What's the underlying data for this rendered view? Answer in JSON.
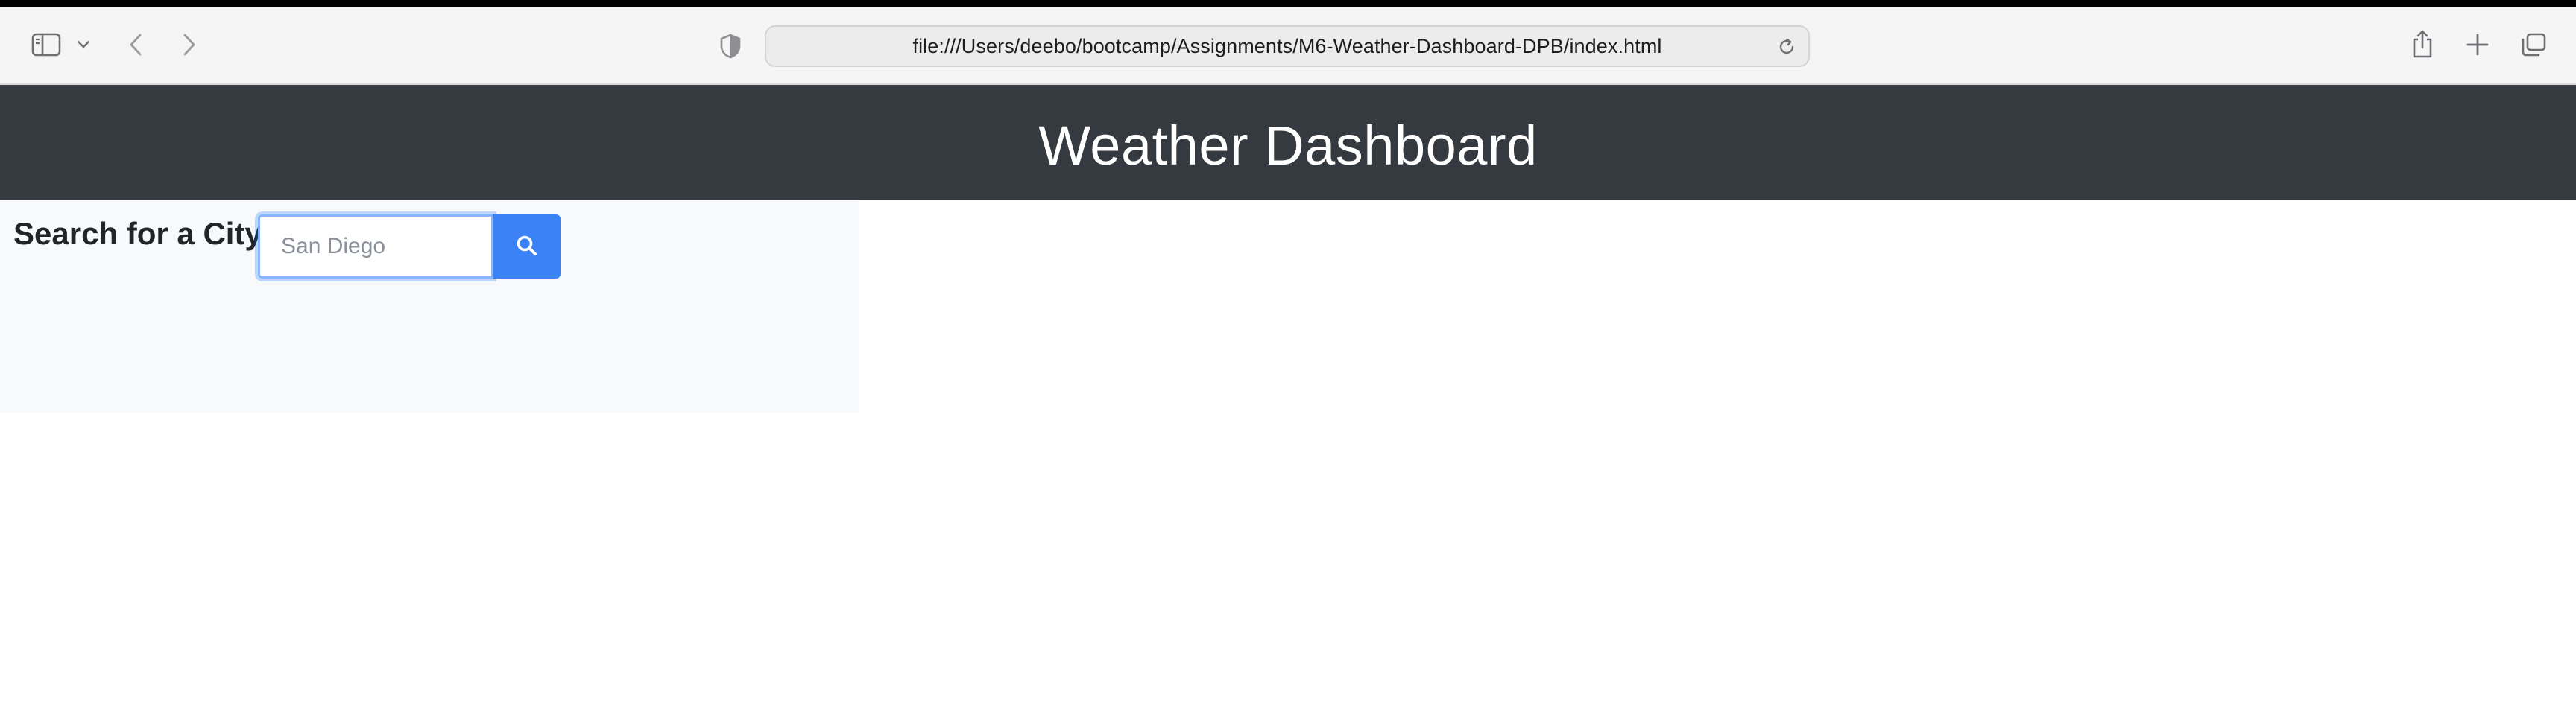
{
  "browser": {
    "url": "file:///Users/deebo/bootcamp/Assignments/M6-Weather-Dashboard-DPB/index.html",
    "icons": {
      "sidebar": "sidebar-icon",
      "tab_groups": "chevron-down-icon",
      "back": "back-arrow-icon",
      "forward": "forward-arrow-icon",
      "privacy": "shield-icon",
      "reload": "reload-icon",
      "share": "share-icon",
      "new_tab": "plus-icon",
      "tab_overview": "tab-overview-icon"
    }
  },
  "header": {
    "title": "Weather Dashboard",
    "background": "#343a40"
  },
  "search": {
    "label": "Search for a City:",
    "placeholder": "San Diego",
    "value": "",
    "button_icon": "search-icon",
    "button_color": "#3b82f6"
  }
}
